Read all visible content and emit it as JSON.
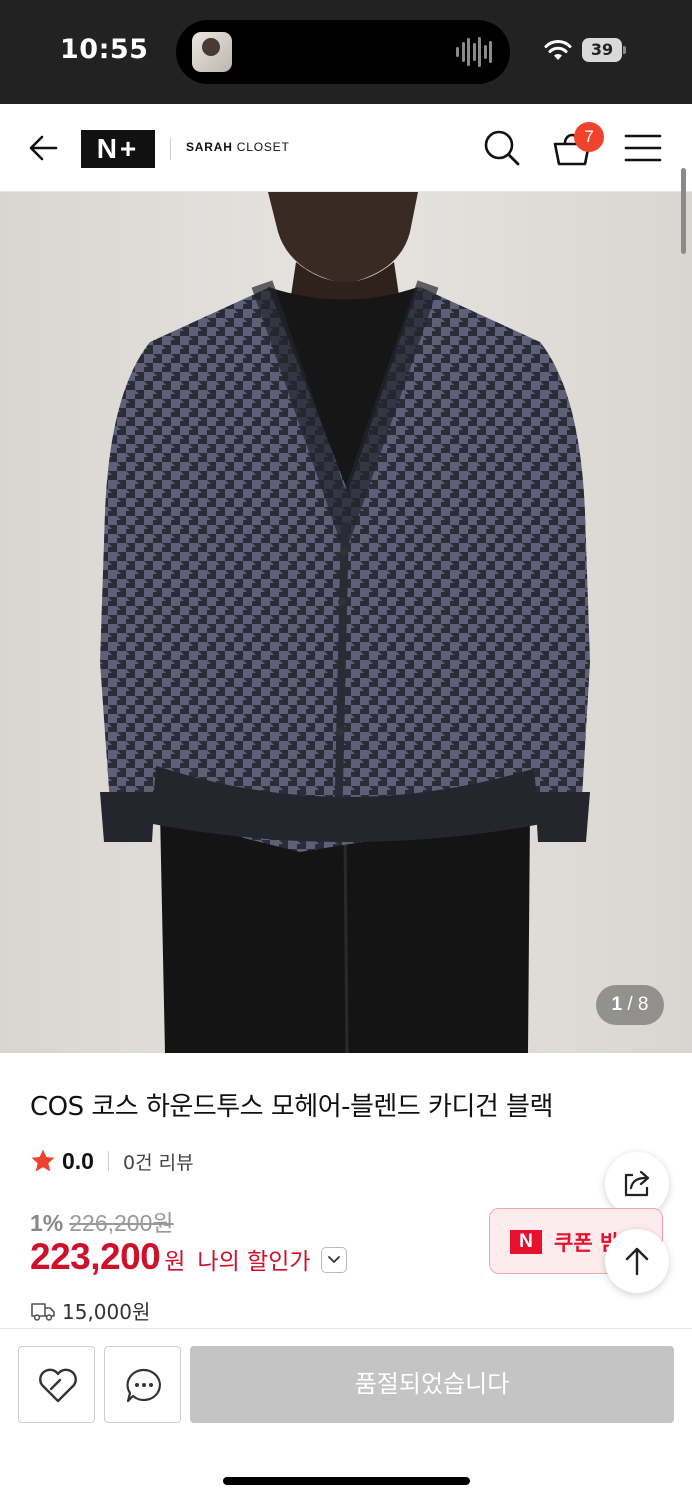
{
  "status_bar": {
    "time": "10:55",
    "battery": "39"
  },
  "header": {
    "brand_logo": "N+",
    "store_name_bold": "SARAH",
    "store_name_rest": " CLOSET",
    "cart_count": "7"
  },
  "gallery": {
    "current": "1",
    "separator": "/",
    "total": "8"
  },
  "product": {
    "title": "COS 코스 하운드투스 모헤어-블렌드 카디건 블랙",
    "rating": "0.0",
    "review_count": "0건 리뷰",
    "discount_rate": "1%",
    "original_price": "226,200원",
    "sale_price": "223,200",
    "price_unit": "원",
    "my_discount_label": "나의 할인가",
    "coupon_label": "쿠폰 받기",
    "shipping_fee": "15,000원"
  },
  "bottom_bar": {
    "soldout_label": "품절되었습니다"
  },
  "colors": {
    "accent_red": "#d0102a",
    "badge_red": "#f0432e",
    "coupon_red": "#e8112d",
    "star": "#f0432e"
  },
  "icons": [
    "back-arrow-icon",
    "search-icon",
    "shopping-bag-icon",
    "hamburger-menu-icon",
    "star-icon",
    "chevron-down-icon",
    "share-icon",
    "arrow-up-icon",
    "truck-icon",
    "heart-icon",
    "chat-bubble-icon",
    "wifi-icon"
  ]
}
